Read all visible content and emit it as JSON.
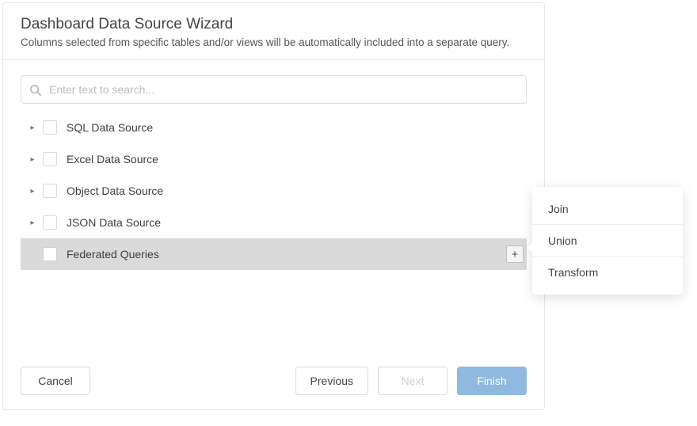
{
  "dialog": {
    "title": "Dashboard Data Source Wizard",
    "subtitle": "Columns selected from specific tables and/or views will be automatically included into a separate query."
  },
  "search": {
    "placeholder": "Enter text to search..."
  },
  "tree": {
    "items": [
      {
        "label": "SQL Data Source",
        "expandable": true,
        "selected": false
      },
      {
        "label": "Excel Data Source",
        "expandable": true,
        "selected": false
      },
      {
        "label": "Object Data Source",
        "expandable": true,
        "selected": false
      },
      {
        "label": "JSON Data Source",
        "expandable": true,
        "selected": false
      },
      {
        "label": "Federated Queries",
        "expandable": false,
        "selected": true
      }
    ]
  },
  "footer": {
    "cancel": "Cancel",
    "previous": "Previous",
    "next": "Next",
    "finish": "Finish"
  },
  "menu": {
    "items": [
      {
        "label": "Join"
      },
      {
        "label": "Union"
      },
      {
        "label": "Transform"
      }
    ]
  },
  "glyphs": {
    "caret_right": "▸",
    "plus": "+"
  }
}
